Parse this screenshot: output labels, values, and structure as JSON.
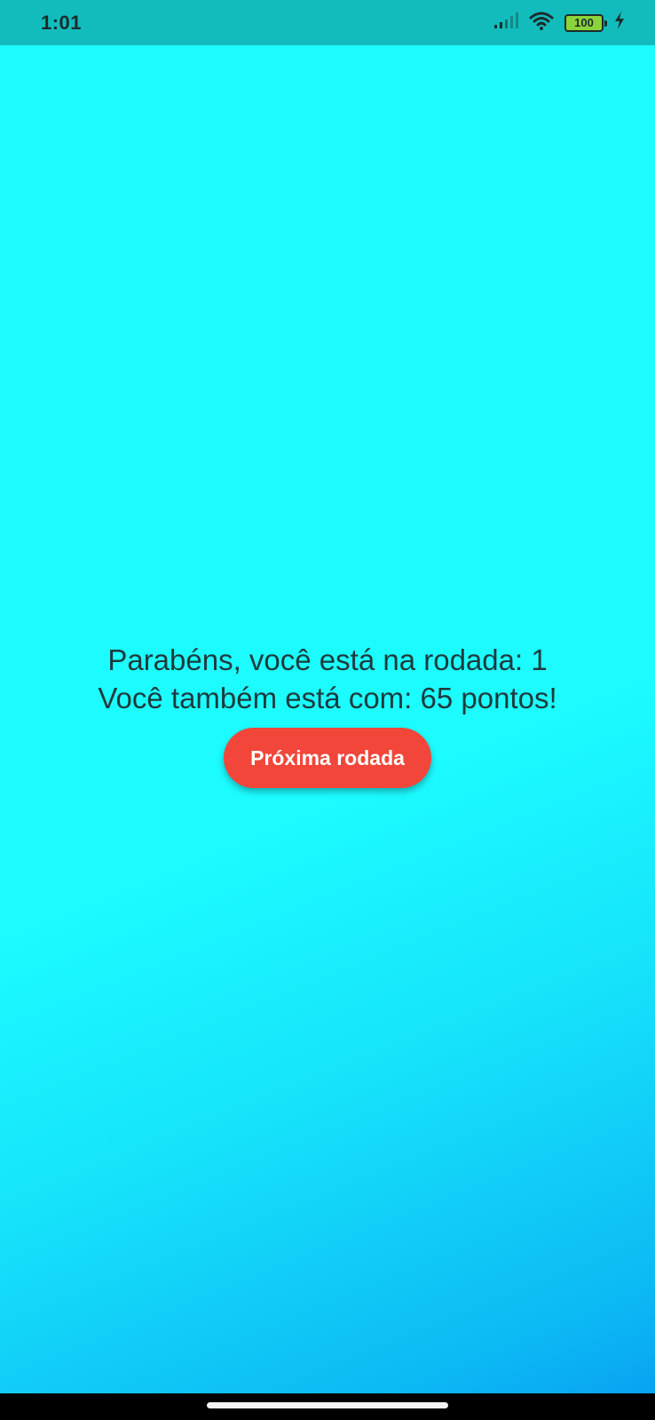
{
  "status_bar": {
    "time": "1:01",
    "battery_level": "100",
    "icons": [
      "signal-icon",
      "wifi-icon",
      "battery-icon",
      "charging-icon"
    ]
  },
  "main": {
    "round_message": "Parabéns, você está na rodada: 1",
    "points_message": "Você também está com: 65 pontos!",
    "next_round_label": "Próxima rodada"
  },
  "colors": {
    "background_top": "#1cfcff",
    "background_bottom": "#079ef0",
    "status_bar": "#12bcbc",
    "button": "#f2463a",
    "text": "#1e3a3d"
  }
}
